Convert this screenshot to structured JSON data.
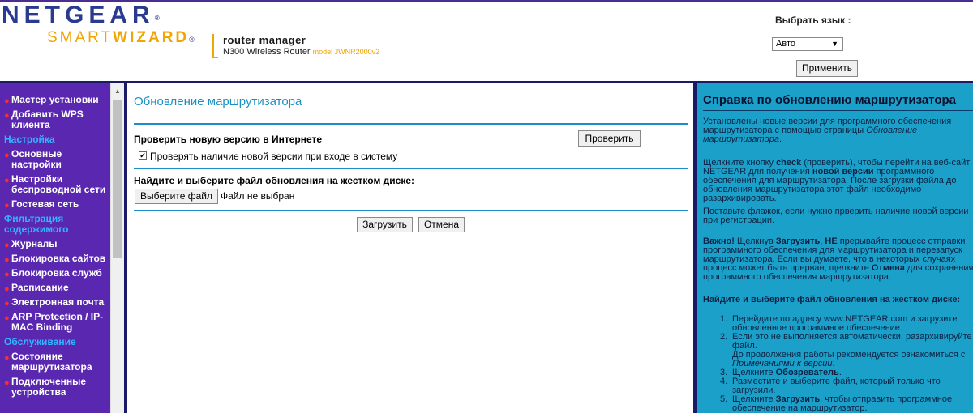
{
  "header": {
    "logo_netgear": "NETGEAR",
    "logo_tm": "®",
    "logo_smart": "SMART",
    "logo_wizard": "WIZARD",
    "logo_reg": "®",
    "product_title": "router manager",
    "product_line": "N300 Wireless Router",
    "product_model": "model JWNR2000v2",
    "language_label": "Выбрать язык :",
    "language_value": "Авто",
    "apply_label": "Применить"
  },
  "sidebar": {
    "entries": [
      {
        "kind": "item",
        "label": "Мастер установки"
      },
      {
        "kind": "item",
        "label": "Добавить WPS клиента"
      },
      {
        "kind": "section",
        "label": "Настройка"
      },
      {
        "kind": "item",
        "label": "Основные настройки"
      },
      {
        "kind": "item",
        "label": "Настройки беспроводной сети"
      },
      {
        "kind": "item",
        "label": "Гостевая сеть"
      },
      {
        "kind": "section",
        "label": "Фильтрация содержимого"
      },
      {
        "kind": "item",
        "label": "Журналы"
      },
      {
        "kind": "item",
        "label": "Блокировка сайтов"
      },
      {
        "kind": "item",
        "label": "Блокировка служб"
      },
      {
        "kind": "item",
        "label": "Расписание"
      },
      {
        "kind": "item",
        "label": "Электронная почта"
      },
      {
        "kind": "item",
        "label": "ARP Protection / IP-MAC Binding"
      },
      {
        "kind": "section",
        "label": "Обслуживание"
      },
      {
        "kind": "item",
        "label": "Состояние маршрутизатора"
      },
      {
        "kind": "item",
        "label": "Подключенные устройства"
      }
    ]
  },
  "main": {
    "title": "Обновление маршрутизатора",
    "check_label": "Проверить новую версию в Интернете",
    "check_button": "Проверить",
    "auto_check_label": "Проверять наличие новой версии при входе в систему",
    "auto_check_checked": true,
    "file_label": "Найдите и выберите файл обновления на жестком диске:",
    "choose_file_button": "Выберите файл",
    "file_status": "Файл не выбран",
    "upload_button": "Загрузить",
    "cancel_button": "Отмена"
  },
  "help": {
    "title": "Справка по обновлению маршрутизатора",
    "p1_a": "Установлены новые версии для программного обеспечения маршрутизатора с помощью страницы ",
    "p1_em": "Обновление маршрутизатора",
    "p1_b": ".",
    "p2_a": "Щелкните кнопку ",
    "p2_b1": "check",
    "p2_c": " (проверить), чтобы перейти на веб-сайт NETGEAR для получения ",
    "p2_b2": "новой версии",
    "p2_d": " программного обеспечения для маршрутизатора. После загрузки файла до обновления маршрутизатора этот файл необходимо разархивировать.",
    "p3": "Поставьте флажок, если нужно прверить наличие новой версии при регистрации.",
    "p4_b1": "Важно!",
    "p4_a": " Щелкнув ",
    "p4_b2": "Загрузить",
    "p4_c": ", ",
    "p4_b3": "НЕ",
    "p4_d": " прерывайте процесс отправки программного обеспечения для маршрутизатора и перезапуск маршрутизатора. Если вы думаете, что в некоторых случаях процесс может быть прерван, щелкните ",
    "p4_b4": "Отмена",
    "p4_e": " для сохранения программного обеспечения маршрутизатора.",
    "subheading": "Найдите и выберите файл обновления на жестком диске:",
    "steps": [
      {
        "num": "1.",
        "text": "Перейдите по адресу www.NETGEAR.com и загрузите обновленное программное обеспечение."
      },
      {
        "num": "2.",
        "text": "Если это не выполняется автоматически, разархивируйте файл.",
        "extra": "До продолжения работы рекомендуется ознакомиться с ",
        "extra_em": "Примечаниями к версии",
        "extra_end": "."
      },
      {
        "num": "3.",
        "text_a": "Щелкните ",
        "text_b": "Обозреватель",
        "text_c": "."
      },
      {
        "num": "4.",
        "text": "Разместите и выберите файл, который только что загрузили."
      },
      {
        "num": "5.",
        "text_a": "Щелкните ",
        "text_b": "Загрузить",
        "text_c": ", чтобы отправить программное обеспечение на маршрутизатор."
      }
    ]
  }
}
